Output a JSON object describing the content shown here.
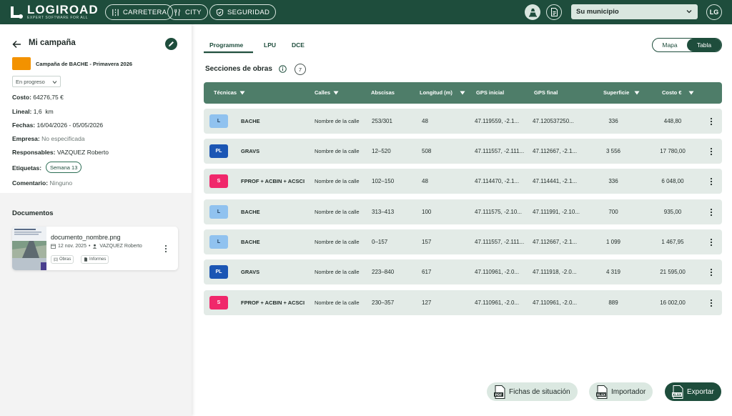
{
  "topbar": {
    "logo_word": "LOGIROAD",
    "logo_tagline": "EXPERT SOFTWARE FOR ALL",
    "nav": [
      {
        "label": "CARRETERA",
        "icon": "road-icon"
      },
      {
        "label": "CITY",
        "icon": "city-icon"
      },
      {
        "label": "SEGURIDAD",
        "icon": "shield-icon"
      }
    ],
    "municipio": "Su municipio",
    "user_initials": "LG"
  },
  "campaign": {
    "title": "Mi campaña",
    "name": "Campaña de BACHE - Primavera 2026",
    "status": "En progreso",
    "color": "#f39200",
    "costo_label": "Costo:",
    "costo_value": "64276,75 €",
    "lineal_label": "Lineal:",
    "lineal_value": "1,6  km",
    "fechas_label": "Fechas:",
    "fechas_value": "16/04/2026 - 05/05/2026",
    "empresa_label": "Empresa:",
    "empresa_value": "No especificada",
    "responsables_label": "Responsables:",
    "responsables_value": "VAZQUEZ Roberto",
    "etiquetas_label": "Etiquetas:",
    "etiquetas_value": "Semana 13",
    "comentario_label": "Comentario:",
    "comentario_value": "Ninguno"
  },
  "documents": {
    "title": "Documentos",
    "items": [
      {
        "name": "documento_nombre.png",
        "date": "12 nov. 2025",
        "author": "VAZQUEZ Roberto",
        "tags": [
          "Obras",
          "Informes"
        ]
      }
    ]
  },
  "tabs": [
    "Programme",
    "LPU",
    "DCE"
  ],
  "active_tab": "Programme",
  "view_toggle": {
    "options": [
      "Mapa",
      "Tabla"
    ],
    "active": "Tabla"
  },
  "section": {
    "title": "Secciones de obras",
    "count": "7"
  },
  "table": {
    "headers": {
      "tecnicas": "Técnicas",
      "calles": "Calles",
      "abscisas": "Abscisas",
      "longitud": "Longitud (m)",
      "gps_inicial": "GPS inicial",
      "gps_final": "GPS final",
      "superficie": "Superficie",
      "costo": "Costo €"
    },
    "rows": [
      {
        "badge": "L",
        "tecnica": "BACHE",
        "calle": "Nombre de la calle",
        "abscisas": "253/301",
        "longitud": "48",
        "gps_inicial": "47.119559, -2.1...",
        "gps_final": "47.120537250...",
        "superficie": "336",
        "costo": "448,80"
      },
      {
        "badge": "PL",
        "tecnica": "GRAVS",
        "calle": "Nombre de la calle",
        "abscisas": "12–520",
        "longitud": "508",
        "gps_inicial": "47.111557, -2.111...",
        "gps_final": "47.112667, -2.1...",
        "superficie": "3 556",
        "costo": "17 780,00"
      },
      {
        "badge": "S",
        "tecnica": "FPROF + ACBIN + ACSCI",
        "calle": "Nombre de la calle",
        "abscisas": "102–150",
        "longitud": "48",
        "gps_inicial": "47.114470, -2.1...",
        "gps_final": "47.114441, -2.1...",
        "superficie": "336",
        "costo": "6 048,00"
      },
      {
        "badge": "L",
        "tecnica": "BACHE",
        "calle": "Nombre de la calle",
        "abscisas": "313–413",
        "longitud": "100",
        "gps_inicial": "47.111575, -2.10...",
        "gps_final": "47.111991, -2.10...",
        "superficie": "700",
        "costo": "935,00"
      },
      {
        "badge": "L",
        "tecnica": "BACHE",
        "calle": "Nombre de la calle",
        "abscisas": "0–157",
        "longitud": "157",
        "gps_inicial": "47.111557, -2.111...",
        "gps_final": "47.112667, -2.1...",
        "superficie": "1 099",
        "costo": "1 467,95"
      },
      {
        "badge": "PL",
        "tecnica": "GRAVS",
        "calle": "Nombre de la calle",
        "abscisas": "223–840",
        "longitud": "617",
        "gps_inicial": "47.110961, -2.0...",
        "gps_final": "47.111918, -2.0...",
        "superficie": "4 319",
        "costo": "21 595,00"
      },
      {
        "badge": "S",
        "tecnica": "FPROF + ACBIN + ACSCI",
        "calle": "Nombre de la calle",
        "abscisas": "230–357",
        "longitud": "127",
        "gps_inicial": "47.110961, -2.0...",
        "gps_final": "47.110961, -2.0...",
        "superficie": "889",
        "costo": "16 002,00"
      }
    ]
  },
  "actions": {
    "fichas": "Fichas de situación",
    "fichas_file": "PDF",
    "importador": "Importador",
    "importador_file": "XLSX",
    "exportar": "Exportar",
    "exportar_file": "XLSX"
  },
  "colors": {
    "primary": "#1e4d3c",
    "table_header": "#4e7d69",
    "row_bg": "#e3ebe7",
    "badge_L": "#90c2ef",
    "badge_PL": "#1b56b4",
    "badge_S": "#f0286b"
  }
}
